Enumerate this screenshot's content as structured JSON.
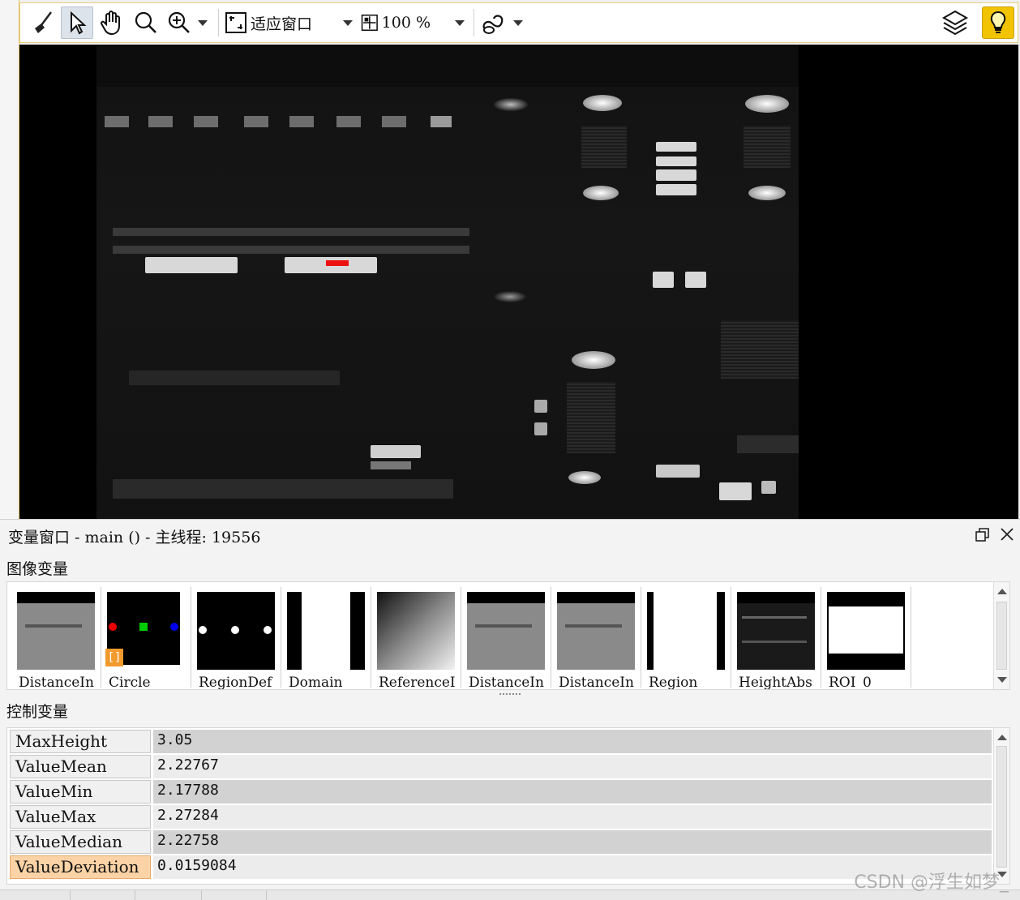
{
  "toolbar": {
    "fit_label": "适应窗口",
    "zoom_label": "100 %"
  },
  "vars_window": {
    "title": "变量窗口 - main () - 主线程: 19556",
    "image_section_label": "图像变量",
    "control_section_label": "控制变量",
    "image_vars": [
      {
        "label": "DistanceIn"
      },
      {
        "label": "Circle"
      },
      {
        "label": "RegionDef"
      },
      {
        "label": "Domain"
      },
      {
        "label": "ReferenceI"
      },
      {
        "label": "DistanceIn"
      },
      {
        "label": "DistanceIn"
      },
      {
        "label": "Region"
      },
      {
        "label": "HeightAbs"
      },
      {
        "label": "ROI_0"
      }
    ],
    "control_vars": [
      {
        "name": "MaxHeight",
        "value": "3.05"
      },
      {
        "name": "ValueMean",
        "value": "2.22767"
      },
      {
        "name": "ValueMin",
        "value": "2.17788"
      },
      {
        "name": "ValueMax",
        "value": "2.27284"
      },
      {
        "name": "ValueMedian",
        "value": "2.22758"
      },
      {
        "name": "ValueDeviation",
        "value": "0.0159084"
      }
    ]
  },
  "watermark": "CSDN @浮生如梦_"
}
